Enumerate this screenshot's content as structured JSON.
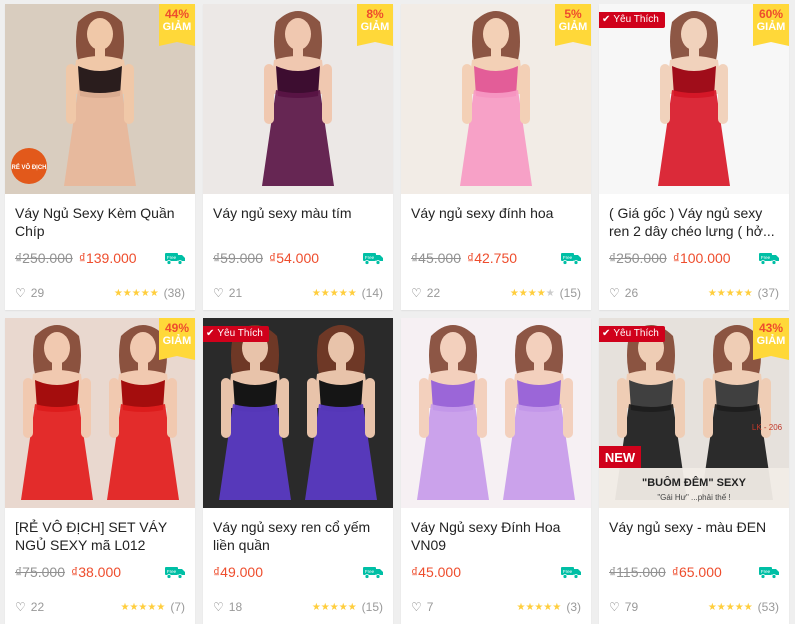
{
  "products": [
    {
      "title": "Váy Ngủ Sexy Kèm Quần Chíp",
      "old_price": "₫250.000",
      "price": "₫139.000",
      "discount_pct": "44%",
      "discount_word": "GIẢM",
      "favorite": "",
      "likes": "29",
      "reviews": "(38)",
      "rating": 5,
      "colors": {
        "bg": "#d9cdbf",
        "dress": "#e8b79a",
        "accent": "#2a1d1d",
        "skin": "#f0c8a8"
      }
    },
    {
      "title": "Váy ngủ sexy màu tím",
      "old_price": "₫59.000",
      "price": "₫54.000",
      "discount_pct": "8%",
      "discount_word": "GIẢM",
      "favorite": "",
      "likes": "21",
      "reviews": "(14)",
      "rating": 4.5,
      "colors": {
        "bg": "#ece8e6",
        "dress": "#5a1547",
        "accent": "#3d0d30",
        "skin": "#f0c8b0"
      }
    },
    {
      "title": "Váy ngủ sexy đính hoa",
      "old_price": "₫45.000",
      "price": "₫42.750",
      "discount_pct": "5%",
      "discount_word": "GIẢM",
      "favorite": "",
      "likes": "22",
      "reviews": "(15)",
      "rating": 4,
      "colors": {
        "bg": "#f2ece6",
        "dress": "#f79ac4",
        "accent": "#e35d98",
        "skin": "#f3d0b6"
      }
    },
    {
      "title": "( Giá gốc ) Váy ngủ sexy ren 2 dây chéo lưng ( hở...",
      "old_price": "₫250.000",
      "price": "₫100.000",
      "discount_pct": "60%",
      "discount_word": "GIẢM",
      "favorite": "Yêu Thích",
      "likes": "26",
      "reviews": "(37)",
      "rating": 5,
      "colors": {
        "bg": "#f7f7f7",
        "dress": "#d81828",
        "accent": "#a00d1a",
        "skin": "#f1d2bc"
      }
    },
    {
      "title": "[RẺ VÔ ĐỊCH] SET VÁY NGỦ SEXY mã L012",
      "old_price": "₫75.000",
      "price": "₫38.000",
      "discount_pct": "49%",
      "discount_word": "GIẢM",
      "favorite": "",
      "likes": "22",
      "reviews": "(7)",
      "rating": 5,
      "colors": {
        "bg": "#e9d8cf",
        "dress": "#e21d1d",
        "accent": "#a40d0d",
        "skin": "#f1c9b0"
      }
    },
    {
      "title": "Váy ngủ sexy ren cổ yếm liền quần",
      "old_price": "",
      "price": "₫49.000",
      "discount_pct": "",
      "discount_word": "",
      "favorite": "Yêu Thích",
      "likes": "18",
      "reviews": "(15)",
      "rating": 5,
      "colors": {
        "bg": "#2a2a2a",
        "dress": "#5b3bc7",
        "accent": "#151515",
        "skin": "#e8c3aa"
      }
    },
    {
      "title": "Váy Ngủ sexy Đính Hoa VN09",
      "old_price": "",
      "price": "₫45.000",
      "discount_pct": "",
      "discount_word": "",
      "favorite": "",
      "likes": "7",
      "reviews": "(3)",
      "rating": 5,
      "colors": {
        "bg": "#f6f0f3",
        "dress": "#c79bea",
        "accent": "#9b66d8",
        "skin": "#f3d0bd"
      }
    },
    {
      "title": "Váy ngủ sexy - màu ĐEN",
      "old_price": "₫115.000",
      "price": "₫65.000",
      "discount_pct": "43%",
      "discount_word": "GIẢM",
      "favorite": "Yêu Thích",
      "likes": "79",
      "reviews": "(53)",
      "rating": 5,
      "colors": {
        "bg": "#e6e1dc",
        "dress": "#1b1b1b",
        "accent": "#404040",
        "skin": "#efcdb5"
      }
    }
  ],
  "icons": {
    "heart": "heart-icon",
    "star": "star-icon",
    "shipping": "free-shipping-icon",
    "check": "check-icon"
  },
  "overlay_texts": {
    "p1_badge": "RẺ VÔ ĐỊCH",
    "p8_new": "NEW",
    "p8_slogan": "\"BUÔM ĐÊM\" SEXY",
    "p8_sub": "\"Gái Hư\" ...phải thế !",
    "p8_code": "LK - 206"
  }
}
